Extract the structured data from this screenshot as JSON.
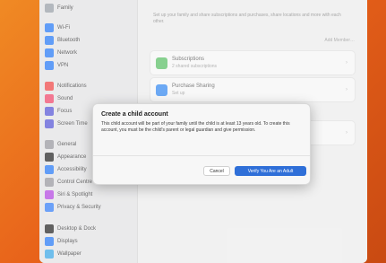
{
  "sidebar": {
    "items": [
      {
        "label": "Family",
        "icon": "family-icon",
        "color": "#9aa0a8"
      },
      {
        "label": "Wi-Fi",
        "icon": "wifi-icon",
        "color": "#2d7df5"
      },
      {
        "label": "Bluetooth",
        "icon": "bluetooth-icon",
        "color": "#2d7df5"
      },
      {
        "label": "Network",
        "icon": "network-icon",
        "color": "#2d7df5"
      },
      {
        "label": "VPN",
        "icon": "vpn-icon",
        "color": "#2d7df5"
      },
      {
        "label": "Notifications",
        "icon": "notifications-icon",
        "color": "#ee4b4b"
      },
      {
        "label": "Sound",
        "icon": "sound-icon",
        "color": "#ee4b6e"
      },
      {
        "label": "Focus",
        "icon": "focus-icon",
        "color": "#5a5ad6"
      },
      {
        "label": "Screen Time",
        "icon": "screen-time-icon",
        "color": "#5a5ad6"
      },
      {
        "label": "General",
        "icon": "general-icon",
        "color": "#9a9aa0"
      },
      {
        "label": "Appearance",
        "icon": "appearance-icon",
        "color": "#2b2b2b"
      },
      {
        "label": "Accessibility",
        "icon": "accessibility-icon",
        "color": "#2d7df5"
      },
      {
        "label": "Control Centre",
        "icon": "control-centre-icon",
        "color": "#9a9aa0"
      },
      {
        "label": "Siri & Spotlight",
        "icon": "siri-icon",
        "color": "#b54be0"
      },
      {
        "label": "Privacy & Security",
        "icon": "privacy-icon",
        "color": "#3b82f6"
      },
      {
        "label": "Desktop & Dock",
        "icon": "desktop-dock-icon",
        "color": "#2b2b2b"
      },
      {
        "label": "Displays",
        "icon": "displays-icon",
        "color": "#2d7df5"
      },
      {
        "label": "Wallpaper",
        "icon": "wallpaper-icon",
        "color": "#3fa8e6"
      }
    ]
  },
  "main": {
    "description": "Set up your family and share subscriptions and purchases, share locations and more with each other.",
    "add_member_label": "Add Member…",
    "cards": [
      {
        "title": "Subscriptions",
        "subtitle": "2 shared subscriptions",
        "icon": "subscriptions-icon",
        "color": "#5fc06a"
      },
      {
        "title": "Purchase Sharing",
        "subtitle": "Set up",
        "icon": "purchase-sharing-icon",
        "color": "#3b8cf0"
      }
    ]
  },
  "dialog": {
    "title": "Create a child account",
    "body": "This child account will be part of your family until the child is at least 13 years old. To create this account, you must be the child's parent or legal guardian and give permission.",
    "cancel_label": "Cancel",
    "verify_label": "Verify You Are an Adult",
    "accent_color": "#2f6fd8"
  }
}
